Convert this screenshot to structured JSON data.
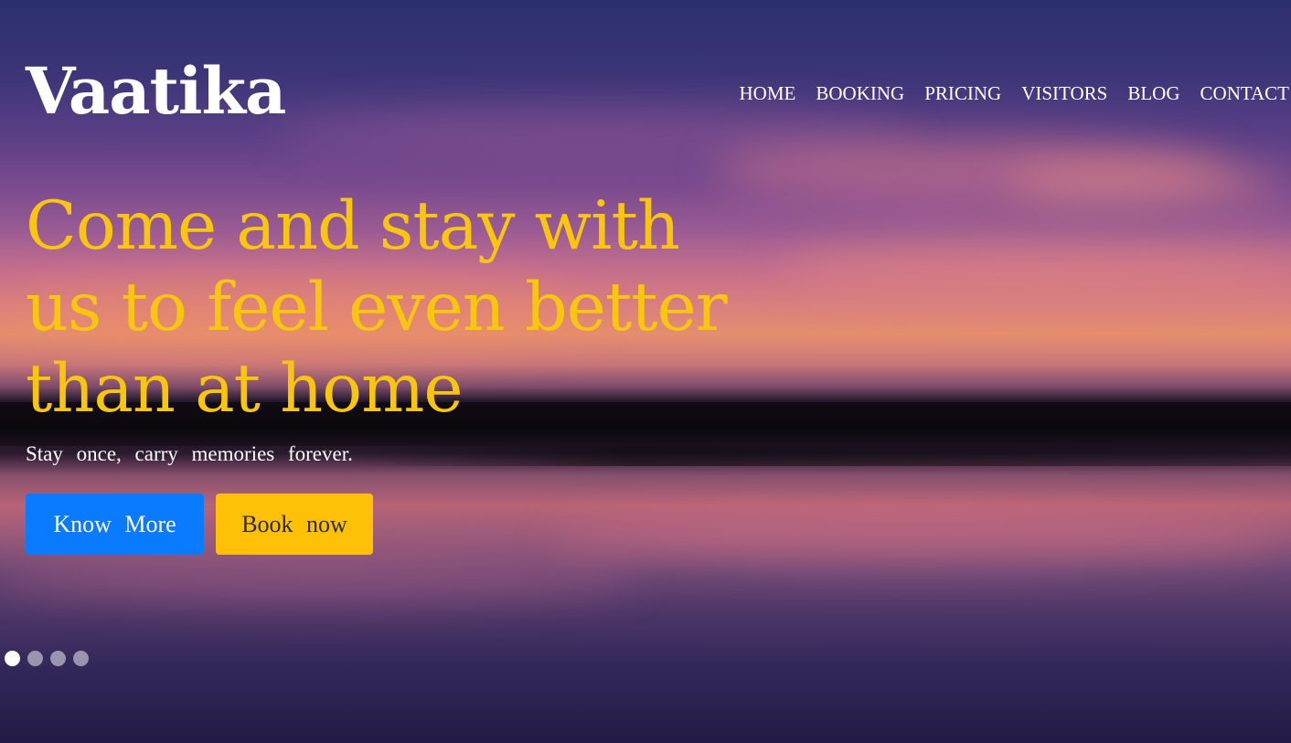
{
  "brand": {
    "name": "Vaatika"
  },
  "nav": {
    "items": [
      {
        "label": "HOME"
      },
      {
        "label": "BOOKING"
      },
      {
        "label": "PRICING"
      },
      {
        "label": "VISITORS"
      },
      {
        "label": "BLOG"
      },
      {
        "label": "CONTACT"
      }
    ]
  },
  "hero": {
    "headline_lines": [
      "Come and stay with",
      "us to feel even better",
      "than at home"
    ],
    "tagline": "Stay once, carry memories forever.",
    "primary_button": "Know More",
    "secondary_button": "Book now"
  },
  "carousel": {
    "slide_count": 4,
    "active_index": 0
  },
  "colors": {
    "headline": "#f8c60e",
    "primary_button": "#0a7bff",
    "secondary_button": "#ffc107",
    "text": "#ffffff"
  }
}
